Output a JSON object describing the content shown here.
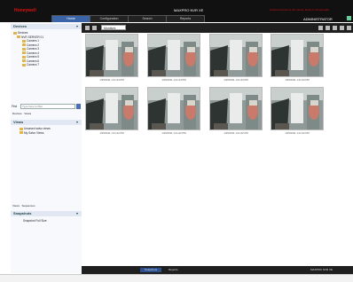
{
  "app": {
    "brand": "Honeywell",
    "title": "MAXPRO NVR XE",
    "notice": "Cannot connect to the server. Retry in 10 seconds.",
    "user": "ADMINISTRATOR"
  },
  "tabs": [
    {
      "label": "Home"
    },
    {
      "label": "Configuration"
    },
    {
      "label": "Search"
    },
    {
      "label": "Reports"
    }
  ],
  "sidebar": {
    "devices_title": "Devices",
    "tree": [
      "Devices",
      "NVR SERVER 01",
      "Camera 1",
      "Camera 2",
      "Camera 3",
      "Camera 4",
      "Camera 5",
      "Camera 6",
      "Camera 7"
    ],
    "find_label": "Find",
    "find_placeholder": "Type here to filter",
    "find_tabs": [
      "Devices",
      "Views"
    ],
    "views_title": "Views",
    "views": [
      "Unsaved salvo views",
      "My Salvo Views"
    ],
    "bottom_tabs": [
      "Views",
      "Sequences"
    ],
    "snapshots_title": "Snapshots",
    "snapshots_text": "Snapshot Full Size"
  },
  "toolbar": {
    "dropdown": "Monitors"
  },
  "thumbnails": [
    {
      "caption": "1/25/2011 1:21:44 PM"
    },
    {
      "caption": "1/25/2011 1:21:44 PM"
    },
    {
      "caption": "1/25/2011 1:21:44 PM"
    },
    {
      "caption": "1/25/2011 1:21:44 PM"
    },
    {
      "caption": "1/25/2011 1:21:42 PM"
    },
    {
      "caption": "1/25/2011 1:21:42 PM"
    },
    {
      "caption": "1/25/2011 1:21:42 PM"
    },
    {
      "caption": "1/25/2011 1:21:42 PM"
    }
  ],
  "bottom": {
    "center_left": "Snapshots",
    "center_right": "Reports",
    "right": "MAXPRO NVR XE"
  },
  "colors": {
    "topbar": "#111111",
    "accent": "#3b63a8",
    "brand": "#dd1111"
  }
}
